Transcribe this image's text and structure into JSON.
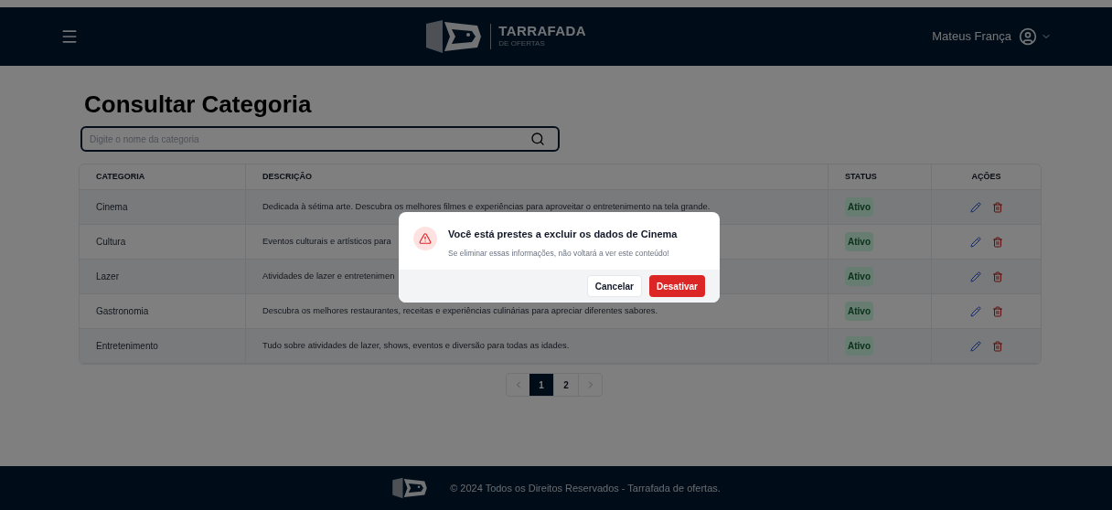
{
  "header": {
    "brand": "TARRAFADA",
    "brand_sub": "DE OFERTAS",
    "user": "Mateus França"
  },
  "title": "Consultar Categoria",
  "search": {
    "placeholder": "Digite o nome da categoria"
  },
  "table": {
    "columns": [
      "CATEGORIA",
      "DESCRIÇÃO",
      "STATUS",
      "AÇÕES"
    ],
    "rows": [
      {
        "category": "Cinema",
        "description": "Dedicada à sétima arte. Descubra os melhores filmes e experiências para aproveitar o entretenimento na tela grande.",
        "status": "Ativo"
      },
      {
        "category": "Cultura",
        "description": "Eventos culturais e artísticos para",
        "status": "Ativo"
      },
      {
        "category": "Lazer",
        "description": "Atividades de lazer e entretenimen",
        "status": "Ativo"
      },
      {
        "category": "Gastronomia",
        "description": "Descubra os melhores restaurantes, receitas e experiências culinárias para apreciar diferentes sabores.",
        "status": "Ativo"
      },
      {
        "category": "Entretenimento",
        "description": "Tudo sobre atividades de lazer, shows, eventos e diversão para todas as idades.",
        "status": "Ativo"
      }
    ]
  },
  "pagination": {
    "pages": [
      {
        "label": "1",
        "selected": true
      },
      {
        "label": "2",
        "selected": false
      }
    ]
  },
  "modal": {
    "title": "Você está prestes a excluir os dados de Cinema",
    "message": "Se eliminar essas informações, não voltará a ver este conteúdo!",
    "buttons": [
      {
        "label": "Cancelar",
        "kind": "secondary"
      },
      {
        "label": "Desativar",
        "kind": "danger"
      }
    ]
  },
  "footer": {
    "text": "© 2024 Todos os Direitos Reservados - Tarrafada de ofertas."
  }
}
